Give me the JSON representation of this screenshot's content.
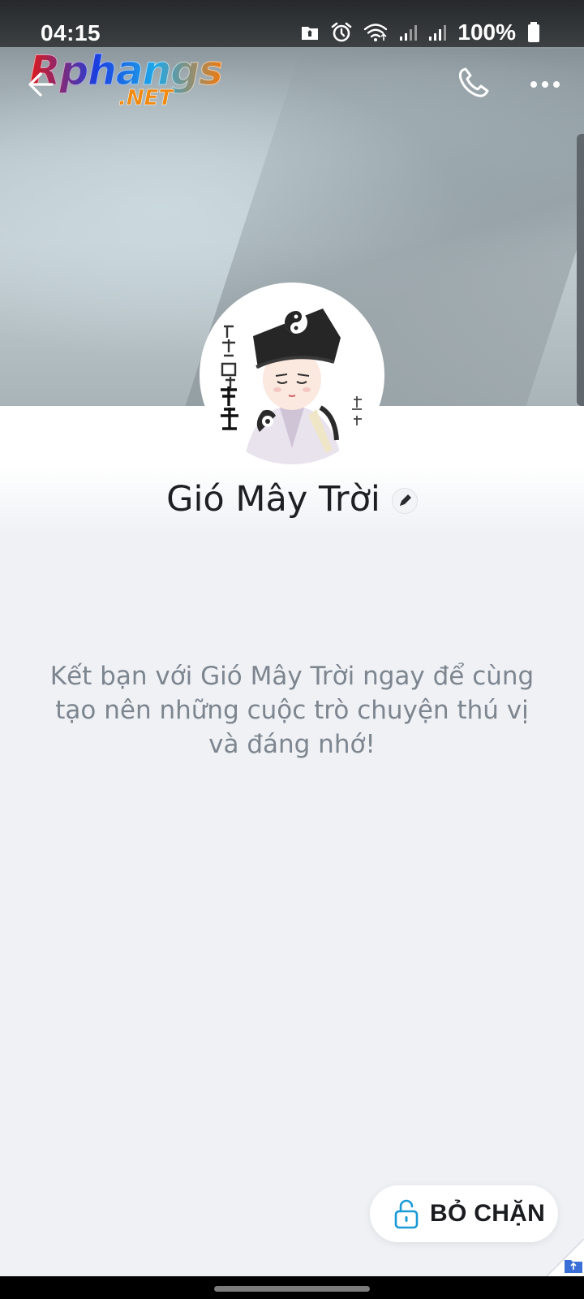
{
  "status_bar": {
    "time": "04:15",
    "battery_text": "100%",
    "icons": [
      "sd-card-icon",
      "alarm-icon",
      "wifi-icon",
      "signal-icon",
      "signal-icon",
      "battery-icon"
    ]
  },
  "watermark": {
    "main": "Rphangs",
    "sub": ".NET"
  },
  "header": {
    "icons": [
      "back-arrow-icon",
      "phone-icon",
      "more-dots-icon"
    ]
  },
  "profile": {
    "name": "Gió Mây Trời",
    "avatar_icon": "taoist-cartoon-avatar"
  },
  "message": {
    "invite": "Kết bạn với Gió Mây Trời ngay để cùng tạo nên những cuộc trò chuyện thú vị và đáng nhớ!"
  },
  "actions": {
    "unblock_label": "BỎ CHẶN",
    "unblock_icon": "unlock-icon"
  },
  "colors": {
    "background": "#eff1f5",
    "text_primary": "#1e1f22",
    "text_secondary": "#7d858f",
    "accent_icon": "#1a9ad6"
  }
}
